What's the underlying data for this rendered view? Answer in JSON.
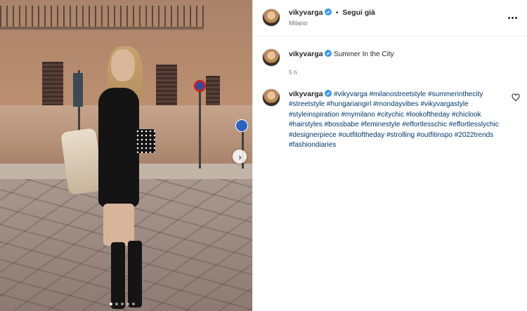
{
  "post": {
    "username": "vikyvarga",
    "follow_label": "Segui già",
    "separator": "•",
    "location": "Milano"
  },
  "caption": {
    "username": "vikyvarga",
    "text": "Summer In the City",
    "time": "5 h"
  },
  "comment": {
    "username": "vikyvarga",
    "hashtags": [
      "#vikyvarga",
      "#milanostreetstyle",
      "#summerinthecity",
      "#streetstyle",
      "#hungariangirl",
      "#mondayvibes",
      "#vikyvargastyle",
      "#styleinspiration",
      "#mymilano",
      "#citychic",
      "#lookoftheday",
      "#chiclook",
      "#hairstyles",
      "#bossbabe",
      "#feminestyle",
      "#effortlesschic",
      "#effortlesslychic",
      "#designerpiece",
      "#outfitoftheday",
      "#strolling",
      "#outfitinspo",
      "#2022trends",
      "#fashiondiaries"
    ]
  },
  "photo": {
    "slide_count": 5,
    "active_slide": 1
  },
  "icons": {
    "verified": "verified-badge-icon",
    "more": "more-horizontal-icon",
    "like": "heart-icon",
    "next": "chevron-right-icon"
  },
  "colors": {
    "verified": "#3897f0",
    "hashtag": "#00376b",
    "muted": "#737373"
  }
}
